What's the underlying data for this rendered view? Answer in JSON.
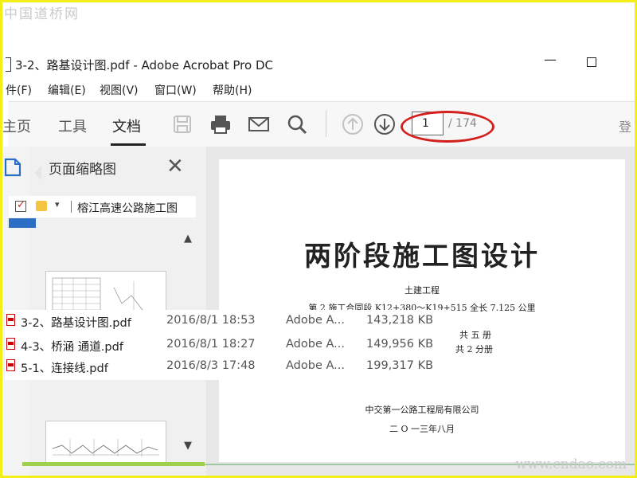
{
  "watermark": {
    "top": "中国道桥网",
    "bottom": "www.cndao.com"
  },
  "window": {
    "title": "3-2、路基设计图.pdf - Adobe Acrobat Pro DC",
    "minimize_glyph": "—",
    "maximize_glyph": ""
  },
  "menu": {
    "items": [
      "件(F)",
      "编辑(E)",
      "视图(V)",
      "窗口(W)",
      "帮助(H)"
    ]
  },
  "toolbar": {
    "tabs": [
      "主页",
      "工具",
      "文档"
    ],
    "active_tab": "文档",
    "icons": [
      "save-icon",
      "print-icon",
      "mail-icon",
      "search-icon",
      "arrow-up-icon",
      "arrow-down-icon"
    ],
    "page_current": "1",
    "page_total": "/ 174",
    "right_partial": "登",
    "highlight_color": "#d3201c"
  },
  "thumbnails_panel": {
    "title": "页面缩略图",
    "close_glyph": "✕",
    "scroll_up_glyph": "▲",
    "scroll_down_glyph": "▼"
  },
  "explorer": {
    "path": "榕江高速公路施工图",
    "check_glyph": "✓",
    "dropdown_glyph": "▾",
    "files": [
      {
        "name": "3-2、路基设计图.pdf",
        "modified": "2016/8/1 18:53",
        "type": "Adobe A...",
        "size": "143,218 KB"
      },
      {
        "name": "4-3、桥涵 通道.pdf",
        "modified": "2016/8/1 18:27",
        "type": "Adobe A...",
        "size": "149,956 KB"
      },
      {
        "name": "5-1、连接线.pdf",
        "modified": "2016/8/3 17:48",
        "type": "Adobe A...",
        "size": "199,317 KB"
      }
    ]
  },
  "document": {
    "title": "两阶段施工图设计",
    "subtitle1": "土建工程",
    "subtitle2": "第 2 施工合同段 K12+380～K19+515 全长 7.125 公里",
    "volume1": "共 五 册",
    "volume2": "共 2 分册",
    "company": "中交第一公路工程局有限公司",
    "date": "二 O 一三年八月"
  }
}
